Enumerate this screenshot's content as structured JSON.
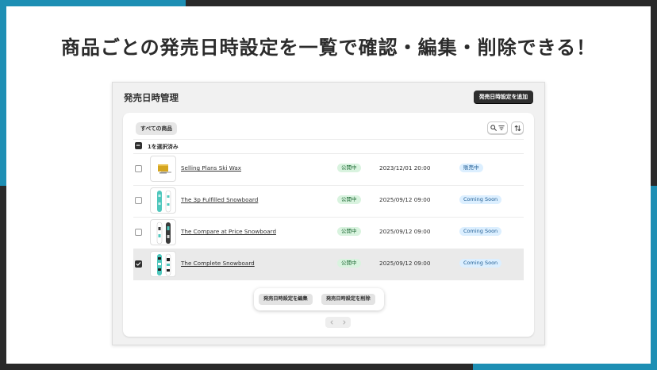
{
  "headline": "商品ごとの発売日時設定を一覧で確認・編集・削除できる！",
  "colors": {
    "accent_blue": "#1e8fb4",
    "frame_dark": "#2a2a2a"
  },
  "app": {
    "title": "発売日時管理",
    "add_button": "発売日時設定を追加",
    "filter_tab": "すべての商品",
    "icons": {
      "search": "search-icon",
      "filter": "filter-lines-icon",
      "sort": "sort-arrows-icon"
    },
    "bulk": {
      "selected_label": "1を選択済み",
      "checkbox_state": "indeterminate"
    },
    "rows": [
      {
        "checked": false,
        "thumbnail": "wax-thumbnail",
        "name": "Selling Plans Ski Wax",
        "visibility": "公開中",
        "release_datetime": "2023/12/01 20:00",
        "status": "販売中"
      },
      {
        "checked": false,
        "thumbnail": "snowboard-thumbnail",
        "name": "The 3p Fulfilled Snowboard",
        "visibility": "公開中",
        "release_datetime": "2025/09/12 09:00",
        "status": "Coming Soon"
      },
      {
        "checked": false,
        "thumbnail": "snowboard-thumbnail",
        "name": "The Compare at Price Snowboard",
        "visibility": "公開中",
        "release_datetime": "2025/09/12 09:00",
        "status": "Coming Soon"
      },
      {
        "checked": true,
        "thumbnail": "snowboard-thumbnail",
        "name": "The Complete Snowboard",
        "visibility": "公開中",
        "release_datetime": "2025/09/12 09:00",
        "status": "Coming Soon"
      }
    ],
    "bulk_actions": {
      "edit": "発売日時設定を編集",
      "delete": "発売日時設定を削除"
    },
    "pagination": {
      "prev": "chevron-left-icon",
      "next": "chevron-right-icon"
    }
  }
}
